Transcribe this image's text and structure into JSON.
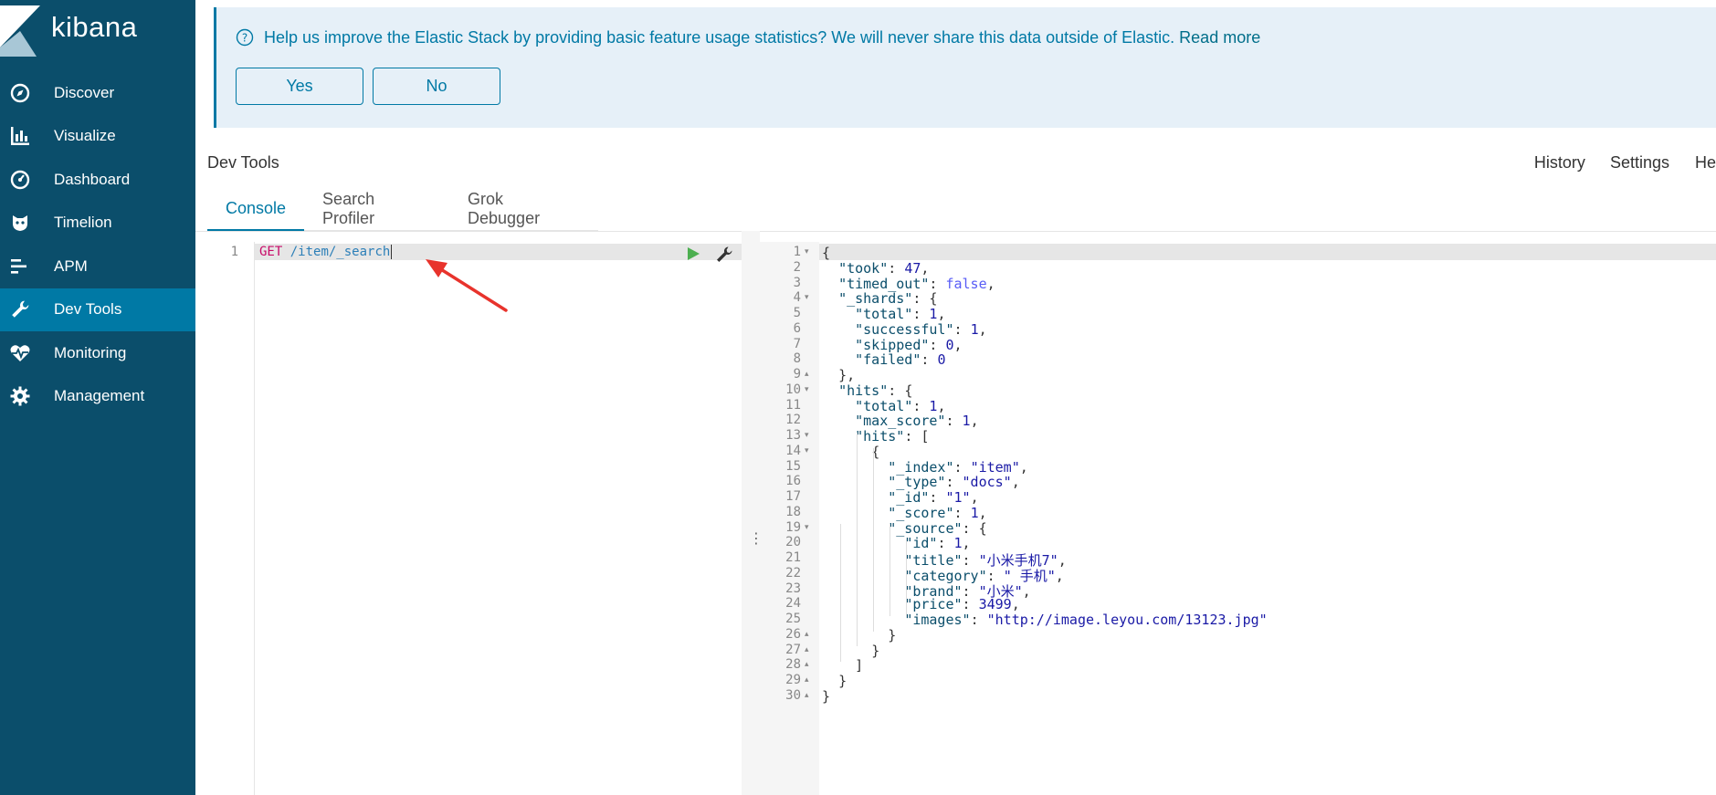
{
  "app": {
    "name": "kibana"
  },
  "sidebar": {
    "items": [
      {
        "label": "Discover",
        "icon": "compass-icon",
        "active": false
      },
      {
        "label": "Visualize",
        "icon": "bar-chart-icon",
        "active": false
      },
      {
        "label": "Dashboard",
        "icon": "gauge-icon",
        "active": false
      },
      {
        "label": "Timelion",
        "icon": "timelion-icon",
        "active": false
      },
      {
        "label": "APM",
        "icon": "apm-icon",
        "active": false
      },
      {
        "label": "Dev Tools",
        "icon": "wrench-icon",
        "active": true
      },
      {
        "label": "Monitoring",
        "icon": "heartbeat-icon",
        "active": false
      },
      {
        "label": "Management",
        "icon": "gear-icon",
        "active": false
      }
    ]
  },
  "banner": {
    "message": "Help us improve the Elastic Stack by providing basic feature usage statistics? We will never share this data outside of Elastic.",
    "link_label": "Read more",
    "yes_label": "Yes",
    "no_label": "No"
  },
  "header": {
    "title": "Dev Tools",
    "links": [
      "History",
      "Settings",
      "He"
    ]
  },
  "tabs": [
    {
      "label": "Console",
      "active": true
    },
    {
      "label": "Search Profiler",
      "active": false
    },
    {
      "label": "Grok Debugger",
      "active": false
    }
  ],
  "editor": {
    "line_number": "1",
    "method": "GET",
    "path": "/item/_search"
  },
  "output": {
    "lines": [
      {
        "n": "1",
        "fold": "▾",
        "text": "{"
      },
      {
        "n": "2",
        "fold": "",
        "text": "  \"took\": 47,"
      },
      {
        "n": "3",
        "fold": "",
        "text": "  \"timed_out\": false,"
      },
      {
        "n": "4",
        "fold": "▾",
        "text": "  \"_shards\": {"
      },
      {
        "n": "5",
        "fold": "",
        "text": "    \"total\": 1,"
      },
      {
        "n": "6",
        "fold": "",
        "text": "    \"successful\": 1,"
      },
      {
        "n": "7",
        "fold": "",
        "text": "    \"skipped\": 0,"
      },
      {
        "n": "8",
        "fold": "",
        "text": "    \"failed\": 0"
      },
      {
        "n": "9",
        "fold": "▴",
        "text": "  },"
      },
      {
        "n": "10",
        "fold": "▾",
        "text": "  \"hits\": {"
      },
      {
        "n": "11",
        "fold": "",
        "text": "    \"total\": 1,"
      },
      {
        "n": "12",
        "fold": "",
        "text": "    \"max_score\": 1,"
      },
      {
        "n": "13",
        "fold": "▾",
        "text": "    \"hits\": ["
      },
      {
        "n": "14",
        "fold": "▾",
        "text": "      {"
      },
      {
        "n": "15",
        "fold": "",
        "text": "        \"_index\": \"item\","
      },
      {
        "n": "16",
        "fold": "",
        "text": "        \"_type\": \"docs\","
      },
      {
        "n": "17",
        "fold": "",
        "text": "        \"_id\": \"1\","
      },
      {
        "n": "18",
        "fold": "",
        "text": "        \"_score\": 1,"
      },
      {
        "n": "19",
        "fold": "▾",
        "text": "        \"_source\": {"
      },
      {
        "n": "20",
        "fold": "",
        "text": "          \"id\": 1,"
      },
      {
        "n": "21",
        "fold": "",
        "text": "          \"title\": \"小米手机7\","
      },
      {
        "n": "22",
        "fold": "",
        "text": "          \"category\": \" 手机\","
      },
      {
        "n": "23",
        "fold": "",
        "text": "          \"brand\": \"小米\","
      },
      {
        "n": "24",
        "fold": "",
        "text": "          \"price\": 3499,"
      },
      {
        "n": "25",
        "fold": "",
        "text": "          \"images\": \"http://image.leyou.com/13123.jpg\""
      },
      {
        "n": "26",
        "fold": "▴",
        "text": "        }"
      },
      {
        "n": "27",
        "fold": "▴",
        "text": "      }"
      },
      {
        "n": "28",
        "fold": "▴",
        "text": "    ]"
      },
      {
        "n": "29",
        "fold": "▴",
        "text": "  }"
      },
      {
        "n": "30",
        "fold": "▴",
        "text": "}"
      }
    ]
  },
  "colors": {
    "sidebar": "#0b4e6b",
    "sidebar_active": "#0079a5",
    "accent": "#0079a5",
    "banner_bg": "#e6f0f8",
    "annotation": "#e8332c"
  }
}
